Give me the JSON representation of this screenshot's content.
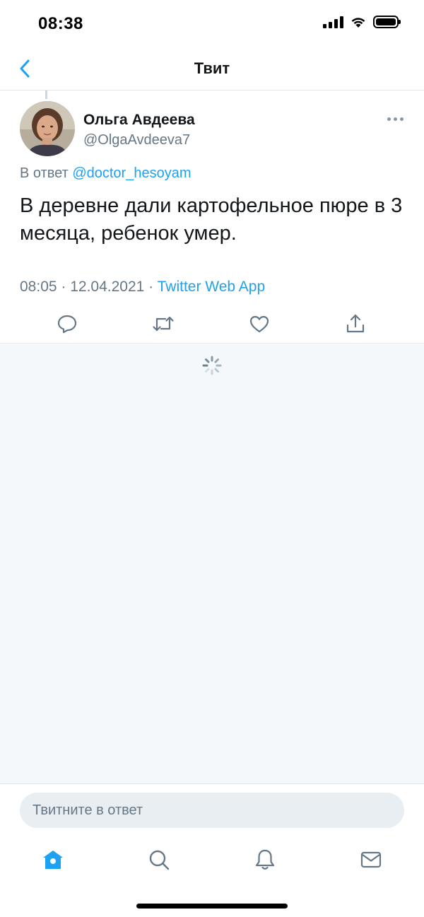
{
  "status_bar": {
    "time": "08:38",
    "icons": [
      "signal-icon",
      "wifi-icon",
      "battery-icon"
    ]
  },
  "nav": {
    "title": "Твит",
    "back_icon": "chevron-left-icon"
  },
  "tweet": {
    "author_name": "Ольга Авдеева",
    "author_handle": "@OlgaAvdeeva7",
    "reply_prefix": "В ответ",
    "reply_mention": "@doctor_hesoyam",
    "text": "В деревне дали картофельное пюре в 3 месяца, ребенок умер.",
    "timestamp": "08:05 · 12.04.2021 · ",
    "source": "Twitter Web App",
    "actions": [
      "reply-icon",
      "retweet-icon",
      "like-icon",
      "share-icon"
    ]
  },
  "composer": {
    "placeholder": "Твитните в ответ"
  },
  "tab_bar": {
    "tabs": [
      "home-icon",
      "search-icon",
      "notifications-icon",
      "messages-icon"
    ],
    "active": "home-icon"
  },
  "colors": {
    "accent": "#1da1f2",
    "secondary_text": "#657786",
    "divider": "#e1e8ed",
    "loading_bg": "#f5f8fa"
  }
}
